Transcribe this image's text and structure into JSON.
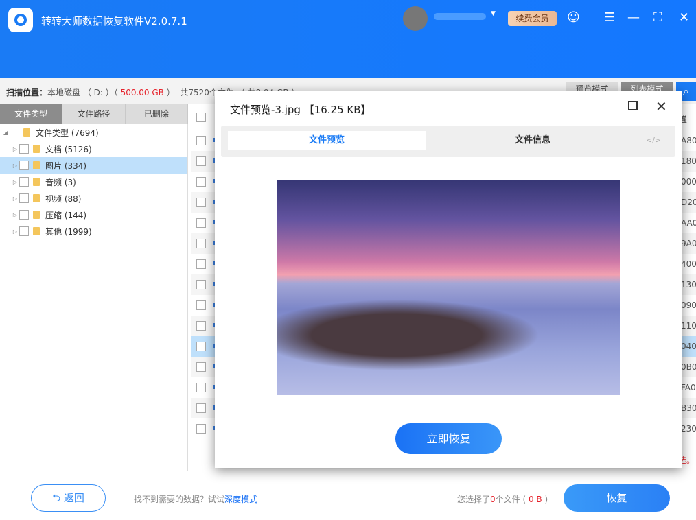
{
  "app": {
    "title": "转转大师数据恢复软件V2.0.7.1",
    "vip_label": "续费会员"
  },
  "scan": {
    "label": "扫描位置：",
    "location": "本地磁盘 （ D: ）（ ",
    "size": "500.00 GB",
    "close": " ）",
    "summary": "共7520个文件 （ 共8.94 GB ）"
  },
  "modes": {
    "preview": "预览模式",
    "list": "列表模式"
  },
  "tabs": [
    "文件类型",
    "文件路径",
    "已删除"
  ],
  "tree": [
    {
      "label": "文件类型 (7694)",
      "level": 0
    },
    {
      "label": "文档 (5126)",
      "level": 1
    },
    {
      "label": "图片 (334)",
      "level": 1,
      "selected": true
    },
    {
      "label": "音频 (3)",
      "level": 1
    },
    {
      "label": "视频 (88)",
      "level": 1
    },
    {
      "label": "压缩 (144)",
      "level": 1
    },
    {
      "label": "其他 (1999)",
      "level": 1
    }
  ],
  "table": {
    "header_tail": "置",
    "rows": [
      "A80",
      "180",
      "000",
      "D20",
      "AA0",
      "9A0",
      "400",
      "130",
      "090",
      "110",
      "040",
      "0B0",
      "FA0",
      "B30",
      "230"
    ],
    "selected_row": 10,
    "footer_tail": "选。"
  },
  "modal": {
    "title": "文件预览-3.jpg 【16.25 KB】",
    "tab_preview": "文件预览",
    "tab_info": "文件信息",
    "code_icon": "</>",
    "restore_now": "立即恢复"
  },
  "footer": {
    "back": "返回",
    "hint": "找不到需要的数据？试试",
    "hint_link": "深度模式",
    "selected_prefix": "您选择了",
    "selected_count": "0",
    "selected_mid": "个文件 ( ",
    "selected_size": "0 B",
    "selected_suffix": " )",
    "restore": "恢复"
  }
}
